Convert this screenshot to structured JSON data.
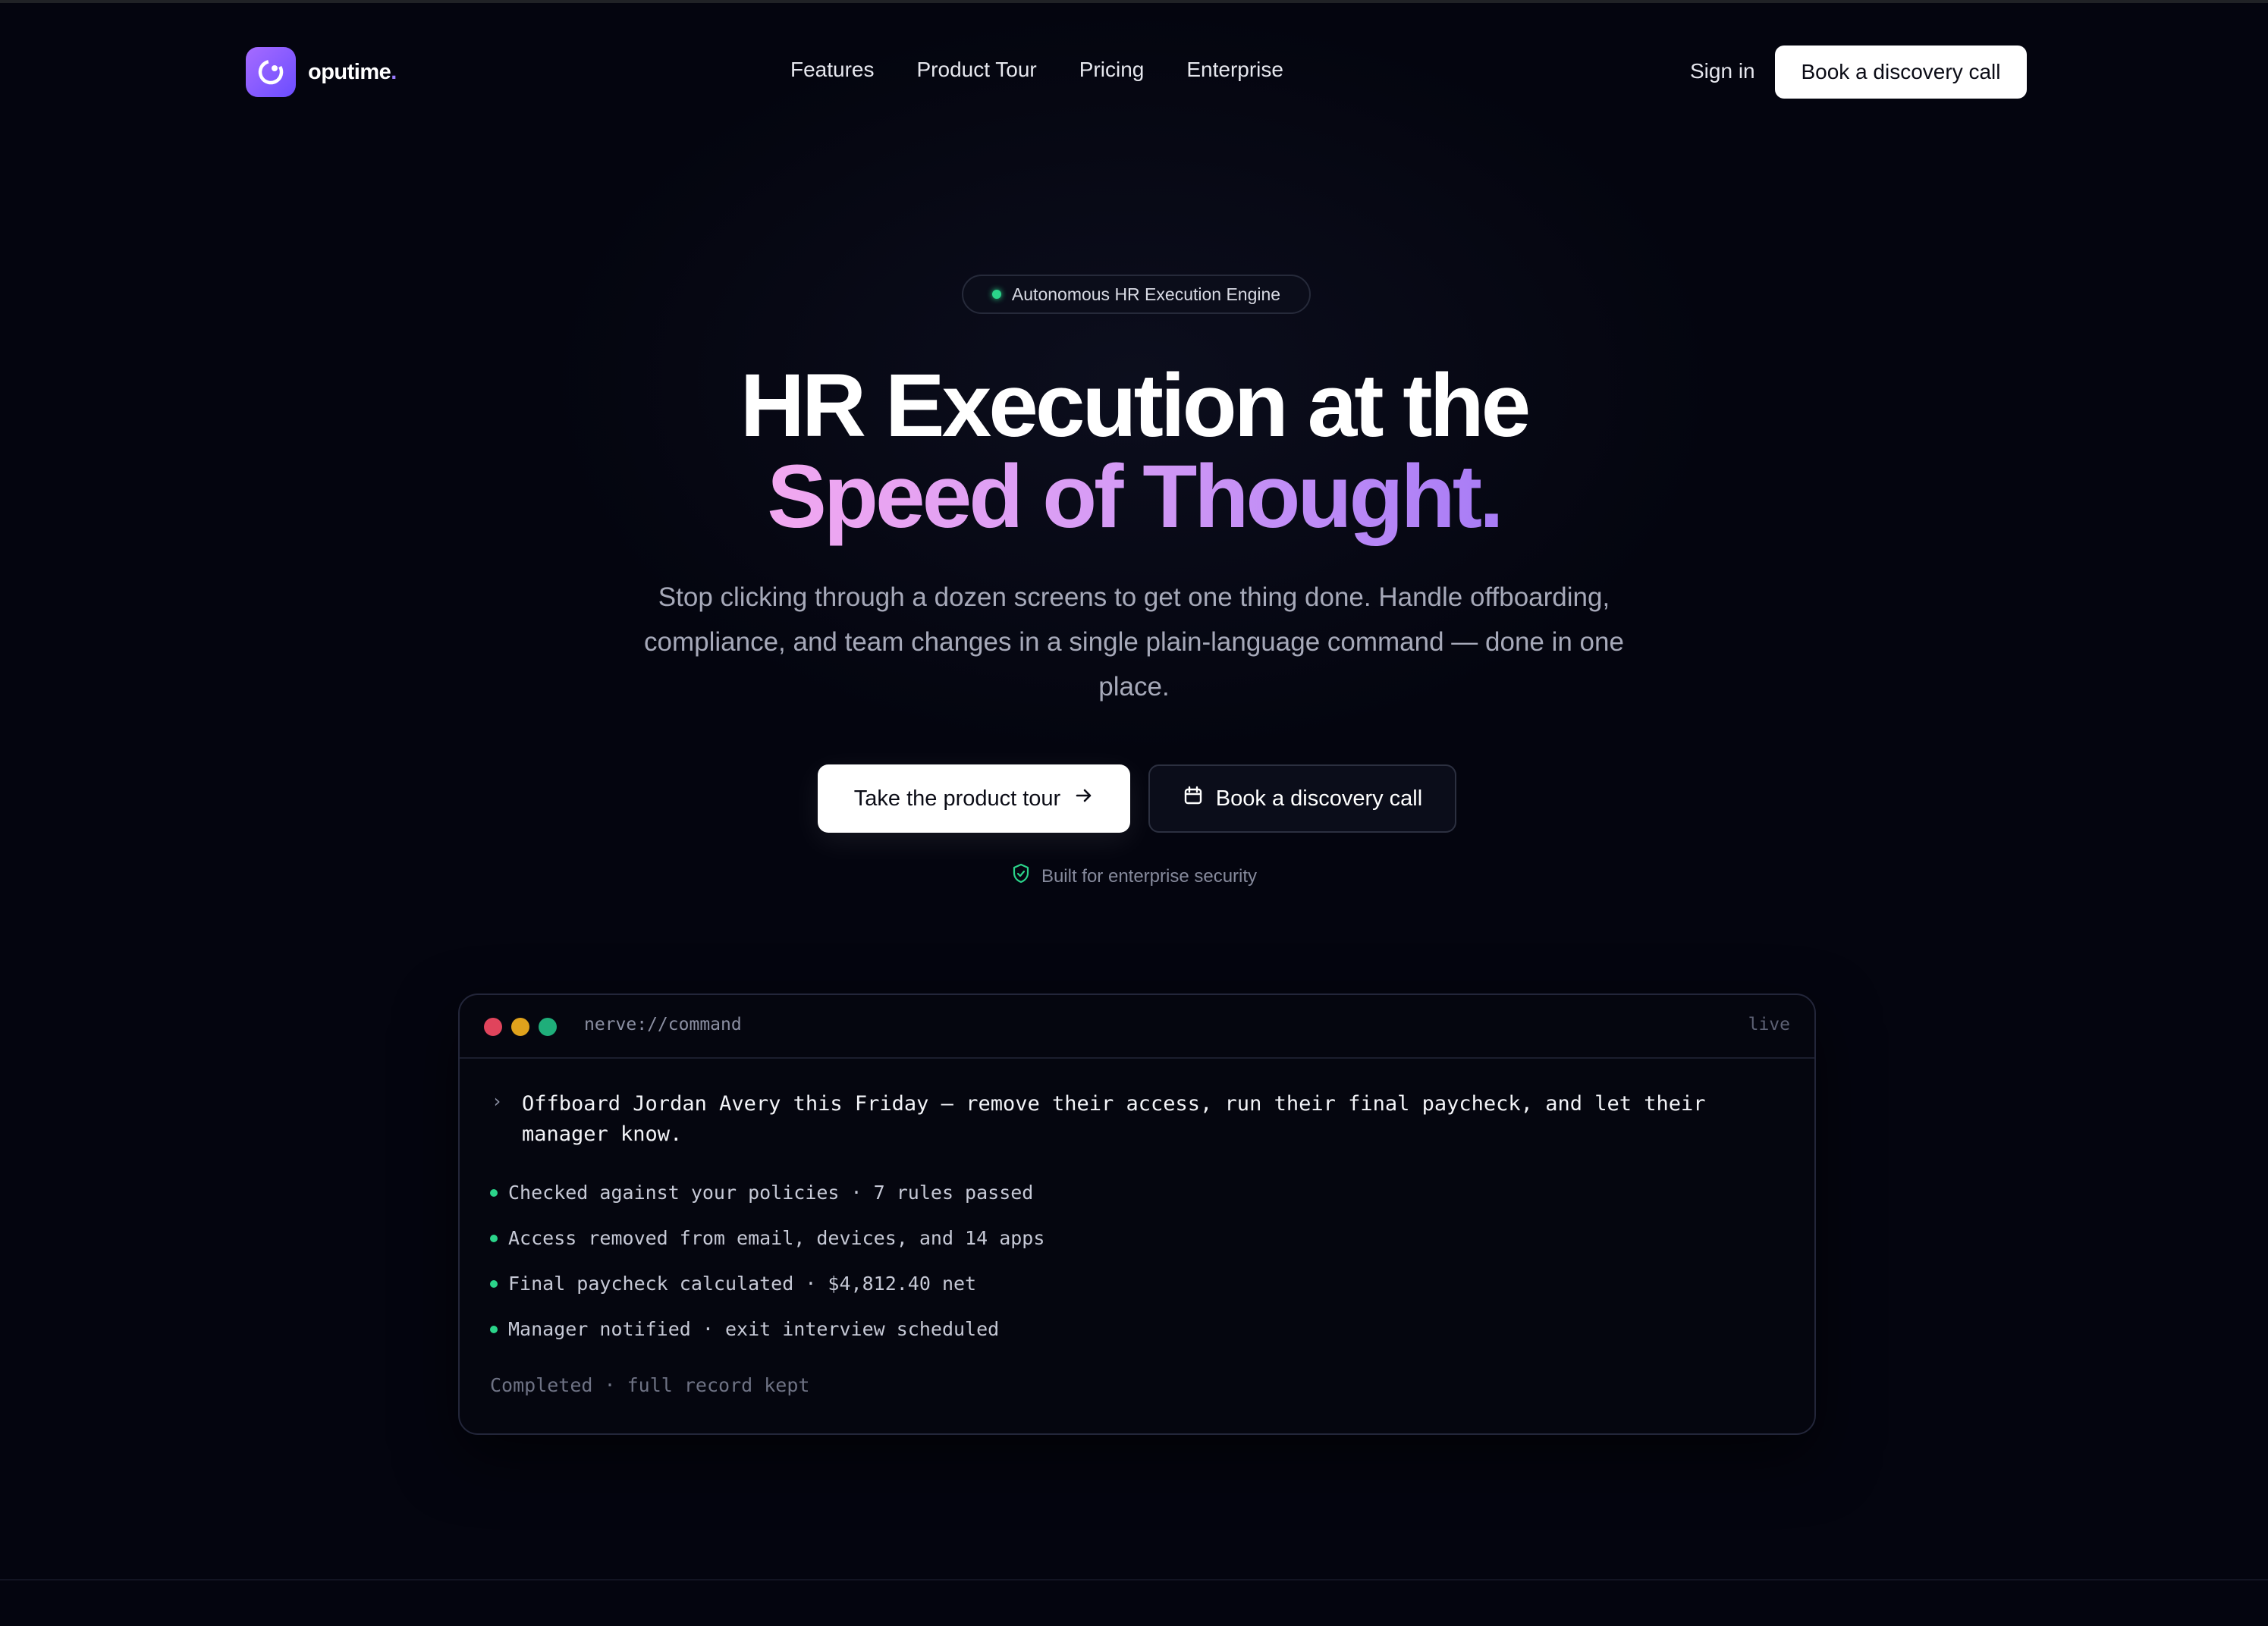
{
  "brand": {
    "name": "oputime",
    "dot": ".",
    "logo_icon": "spark-circle-icon",
    "accent": "#8b5cf6"
  },
  "nav": {
    "links": [
      "Features",
      "Product Tour",
      "Pricing",
      "Enterprise"
    ],
    "sign_in": "Sign in",
    "cta": "Book a discovery call"
  },
  "hero": {
    "badge": "Autonomous HR Execution Engine",
    "title_line1": "HR Execution at the",
    "title_line2": "Speed of Thought.",
    "subtitle": "Stop clicking through a dozen screens to get one thing done. Handle offboarding, compliance, and team changes in a single plain-language command — done in one place.",
    "primary_cta": "Take the product tour",
    "secondary_cta": "Book a discovery call",
    "security_note": "Built for enterprise security"
  },
  "terminal": {
    "url": "nerve://command",
    "status": "live",
    "prompt": "›",
    "command": "Offboard Jordan Avery this Friday — remove their access, run their final paycheck, and let their manager know.",
    "steps": [
      "Checked against your policies · 7 rules passed",
      "Access removed from email, devices, and 14 apps",
      "Final paycheck calculated · $4,812.40 net",
      "Manager notified · exit interview scheduled"
    ],
    "footer": "Completed · full record kept"
  }
}
